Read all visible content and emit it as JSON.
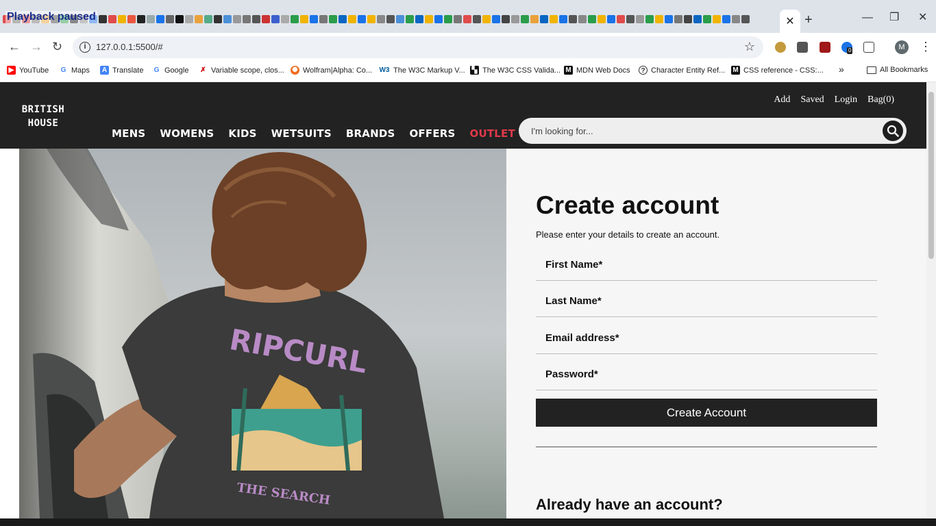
{
  "browser": {
    "playback_label": "Playback paused",
    "active_tab_close": "✕",
    "new_tab": "+",
    "window_buttons": {
      "minimize": "—",
      "restore": "❐",
      "close": "✕"
    },
    "url": "127.0.0.1:5500/#",
    "extension_badge": "0",
    "profile_initial": "M",
    "bookmarks": [
      {
        "label": "YouTube",
        "color": "#ff0000"
      },
      {
        "label": "Maps",
        "color": "#4285f4"
      },
      {
        "label": "Translate",
        "color": "#4285f4"
      },
      {
        "label": "Google",
        "color": "#4285f4"
      },
      {
        "label": "Variable scope, clos...",
        "color": "#c00"
      },
      {
        "label": "Wolfram|Alpha: Co...",
        "color": "#f26b1d"
      },
      {
        "label": "The W3C Markup V...",
        "color": "#005a9c"
      },
      {
        "label": "The W3C CSS Valida...",
        "color": "#111"
      },
      {
        "label": "MDN Web Docs",
        "color": "#111"
      },
      {
        "label": "Character Entity Ref...",
        "color": "#333"
      },
      {
        "label": "CSS reference - CSS:...",
        "color": "#111"
      }
    ],
    "bookmarks_overflow": "»",
    "all_bookmarks": "All Bookmarks"
  },
  "site": {
    "logo_line1": "BRITISH",
    "logo_line2": "HOUSE",
    "nav": {
      "mens": "MENS",
      "womens": "WOMENS",
      "kids": "KIDS",
      "wetsuits": "WETSUITS",
      "brands": "BRANDS",
      "offers": "OFFERS",
      "outlet": "OUTLET"
    },
    "outlet_color": "#e0394a",
    "util": {
      "add": "Add",
      "saved": "Saved",
      "login": "Login",
      "bag": "Bag(0)"
    },
    "search_placeholder": "I'm looking for..."
  },
  "hero": {
    "shirt_brand": "RIPCURL",
    "shirt_tagline": "THE SEARCH"
  },
  "form": {
    "title": "Create account",
    "subtitle": "Please enter your details to create an account.",
    "first_name": "First Name*",
    "last_name": "Last Name*",
    "email": "Email address*",
    "password": "Password*",
    "submit": "Create Account",
    "already": "Already have an account?"
  }
}
